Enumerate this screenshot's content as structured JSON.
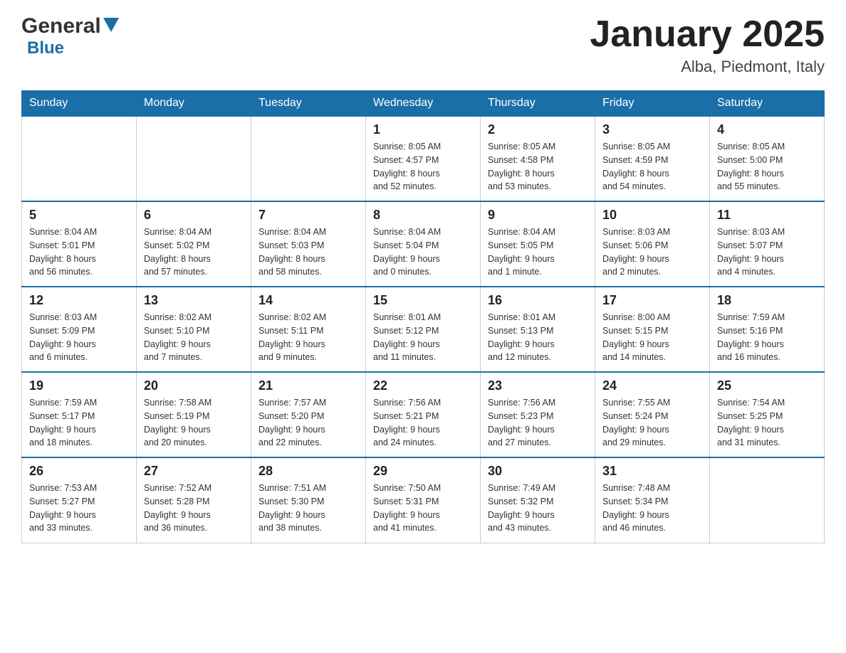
{
  "header": {
    "logo_general": "General",
    "logo_blue": "Blue",
    "title": "January 2025",
    "subtitle": "Alba, Piedmont, Italy"
  },
  "days_of_week": [
    "Sunday",
    "Monday",
    "Tuesday",
    "Wednesday",
    "Thursday",
    "Friday",
    "Saturday"
  ],
  "weeks": [
    [
      {
        "day": "",
        "info": ""
      },
      {
        "day": "",
        "info": ""
      },
      {
        "day": "",
        "info": ""
      },
      {
        "day": "1",
        "info": "Sunrise: 8:05 AM\nSunset: 4:57 PM\nDaylight: 8 hours\nand 52 minutes."
      },
      {
        "day": "2",
        "info": "Sunrise: 8:05 AM\nSunset: 4:58 PM\nDaylight: 8 hours\nand 53 minutes."
      },
      {
        "day": "3",
        "info": "Sunrise: 8:05 AM\nSunset: 4:59 PM\nDaylight: 8 hours\nand 54 minutes."
      },
      {
        "day": "4",
        "info": "Sunrise: 8:05 AM\nSunset: 5:00 PM\nDaylight: 8 hours\nand 55 minutes."
      }
    ],
    [
      {
        "day": "5",
        "info": "Sunrise: 8:04 AM\nSunset: 5:01 PM\nDaylight: 8 hours\nand 56 minutes."
      },
      {
        "day": "6",
        "info": "Sunrise: 8:04 AM\nSunset: 5:02 PM\nDaylight: 8 hours\nand 57 minutes."
      },
      {
        "day": "7",
        "info": "Sunrise: 8:04 AM\nSunset: 5:03 PM\nDaylight: 8 hours\nand 58 minutes."
      },
      {
        "day": "8",
        "info": "Sunrise: 8:04 AM\nSunset: 5:04 PM\nDaylight: 9 hours\nand 0 minutes."
      },
      {
        "day": "9",
        "info": "Sunrise: 8:04 AM\nSunset: 5:05 PM\nDaylight: 9 hours\nand 1 minute."
      },
      {
        "day": "10",
        "info": "Sunrise: 8:03 AM\nSunset: 5:06 PM\nDaylight: 9 hours\nand 2 minutes."
      },
      {
        "day": "11",
        "info": "Sunrise: 8:03 AM\nSunset: 5:07 PM\nDaylight: 9 hours\nand 4 minutes."
      }
    ],
    [
      {
        "day": "12",
        "info": "Sunrise: 8:03 AM\nSunset: 5:09 PM\nDaylight: 9 hours\nand 6 minutes."
      },
      {
        "day": "13",
        "info": "Sunrise: 8:02 AM\nSunset: 5:10 PM\nDaylight: 9 hours\nand 7 minutes."
      },
      {
        "day": "14",
        "info": "Sunrise: 8:02 AM\nSunset: 5:11 PM\nDaylight: 9 hours\nand 9 minutes."
      },
      {
        "day": "15",
        "info": "Sunrise: 8:01 AM\nSunset: 5:12 PM\nDaylight: 9 hours\nand 11 minutes."
      },
      {
        "day": "16",
        "info": "Sunrise: 8:01 AM\nSunset: 5:13 PM\nDaylight: 9 hours\nand 12 minutes."
      },
      {
        "day": "17",
        "info": "Sunrise: 8:00 AM\nSunset: 5:15 PM\nDaylight: 9 hours\nand 14 minutes."
      },
      {
        "day": "18",
        "info": "Sunrise: 7:59 AM\nSunset: 5:16 PM\nDaylight: 9 hours\nand 16 minutes."
      }
    ],
    [
      {
        "day": "19",
        "info": "Sunrise: 7:59 AM\nSunset: 5:17 PM\nDaylight: 9 hours\nand 18 minutes."
      },
      {
        "day": "20",
        "info": "Sunrise: 7:58 AM\nSunset: 5:19 PM\nDaylight: 9 hours\nand 20 minutes."
      },
      {
        "day": "21",
        "info": "Sunrise: 7:57 AM\nSunset: 5:20 PM\nDaylight: 9 hours\nand 22 minutes."
      },
      {
        "day": "22",
        "info": "Sunrise: 7:56 AM\nSunset: 5:21 PM\nDaylight: 9 hours\nand 24 minutes."
      },
      {
        "day": "23",
        "info": "Sunrise: 7:56 AM\nSunset: 5:23 PM\nDaylight: 9 hours\nand 27 minutes."
      },
      {
        "day": "24",
        "info": "Sunrise: 7:55 AM\nSunset: 5:24 PM\nDaylight: 9 hours\nand 29 minutes."
      },
      {
        "day": "25",
        "info": "Sunrise: 7:54 AM\nSunset: 5:25 PM\nDaylight: 9 hours\nand 31 minutes."
      }
    ],
    [
      {
        "day": "26",
        "info": "Sunrise: 7:53 AM\nSunset: 5:27 PM\nDaylight: 9 hours\nand 33 minutes."
      },
      {
        "day": "27",
        "info": "Sunrise: 7:52 AM\nSunset: 5:28 PM\nDaylight: 9 hours\nand 36 minutes."
      },
      {
        "day": "28",
        "info": "Sunrise: 7:51 AM\nSunset: 5:30 PM\nDaylight: 9 hours\nand 38 minutes."
      },
      {
        "day": "29",
        "info": "Sunrise: 7:50 AM\nSunset: 5:31 PM\nDaylight: 9 hours\nand 41 minutes."
      },
      {
        "day": "30",
        "info": "Sunrise: 7:49 AM\nSunset: 5:32 PM\nDaylight: 9 hours\nand 43 minutes."
      },
      {
        "day": "31",
        "info": "Sunrise: 7:48 AM\nSunset: 5:34 PM\nDaylight: 9 hours\nand 46 minutes."
      },
      {
        "day": "",
        "info": ""
      }
    ]
  ]
}
